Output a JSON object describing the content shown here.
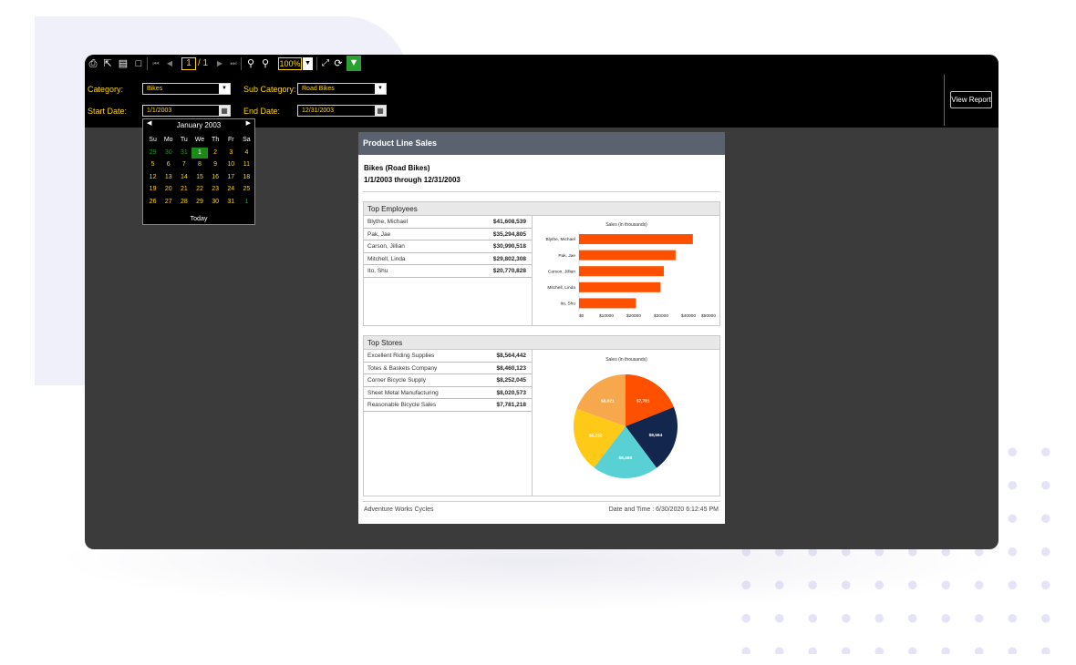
{
  "toolbar": {
    "page_current": "1",
    "page_total": "/ 1",
    "zoom": "100%"
  },
  "params": {
    "category_label": "Category:",
    "category_value": "Bikes",
    "subcategory_label": "Sub Category:",
    "subcategory_value": "Road Bikes",
    "start_label": "Start Date:",
    "start_value": "1/1/2003",
    "end_label": "End Date:",
    "end_value": "12/31/2003",
    "view_report": "View Report"
  },
  "calendar": {
    "month": "January 2003",
    "days_of_week": [
      "Su",
      "Mo",
      "Tu",
      "We",
      "Th",
      "Fr",
      "Sa"
    ],
    "weeks": [
      [
        "29",
        "30",
        "31",
        "1",
        "2",
        "3",
        "4"
      ],
      [
        "5",
        "6",
        "7",
        "8",
        "9",
        "10",
        "11"
      ],
      [
        "12",
        "13",
        "14",
        "15",
        "16",
        "17",
        "18"
      ],
      [
        "19",
        "20",
        "21",
        "22",
        "23",
        "24",
        "25"
      ],
      [
        "26",
        "27",
        "28",
        "29",
        "30",
        "31",
        "1"
      ]
    ],
    "selected_day": "1",
    "today_label": "Today"
  },
  "report": {
    "header": "Product Line Sales",
    "subtitle": "Bikes (Road Bikes)",
    "range": "1/1/2003 through 12/31/2003",
    "footer_left": "Adventure Works Cycles",
    "footer_right": "Date and Time : 6/30/2020 6:12:45 PM",
    "top_employees": {
      "title": "Top Employees",
      "rows": [
        {
          "name": "Blythe, Michael",
          "value": "$41,608,539"
        },
        {
          "name": "Pak, Jae",
          "value": "$35,294,805"
        },
        {
          "name": "Carson, Jillian",
          "value": "$30,990,518"
        },
        {
          "name": "Mitchell, Linda",
          "value": "$29,802,308"
        },
        {
          "name": "Ito, Shu",
          "value": "$20,770,828"
        }
      ]
    },
    "top_stores": {
      "title": "Top Stores",
      "rows": [
        {
          "name": "Excellent Riding Supplies",
          "value": "$8,564,442"
        },
        {
          "name": "Totes & Baskets Company",
          "value": "$8,460,123"
        },
        {
          "name": "Corner Bicycle Supply",
          "value": "$8,252,045"
        },
        {
          "name": "Sheet Metal Manufacturing",
          "value": "$8,020,573"
        },
        {
          "name": "Reasonable Bicycle Sales",
          "value": "$7,781,218"
        }
      ]
    }
  },
  "chart_data": [
    {
      "type": "bar",
      "orientation": "horizontal",
      "title": "Sales (in thousands)",
      "categories": [
        "Blythe, Michael",
        "Pak, Jae",
        "Carson, Jillian",
        "Mitchell, Linda",
        "Ito, Shu"
      ],
      "values": [
        41608.539,
        35294.805,
        30990.518,
        29802.308,
        20770.828
      ],
      "tick_labels": [
        "$0",
        "$10000",
        "$20000",
        "$30000",
        "$40000",
        "$50000"
      ],
      "xlim": [
        0,
        50000
      ],
      "color": "#ff5000",
      "grid": false
    },
    {
      "type": "pie",
      "title": "Sales (in thousands)",
      "slices": [
        {
          "label": "$7,781",
          "value": 7781.218,
          "color": "#ff5000"
        },
        {
          "label": "$8,564",
          "value": 8564.442,
          "color": "#13264d"
        },
        {
          "label": "$8,460",
          "value": 8460.123,
          "color": "#59d0d4"
        },
        {
          "label": "$8,252",
          "value": 8252.045,
          "color": "#ffc917"
        },
        {
          "label": "$8,021",
          "value": 8020.573,
          "color": "#f7a84c"
        }
      ]
    }
  ]
}
